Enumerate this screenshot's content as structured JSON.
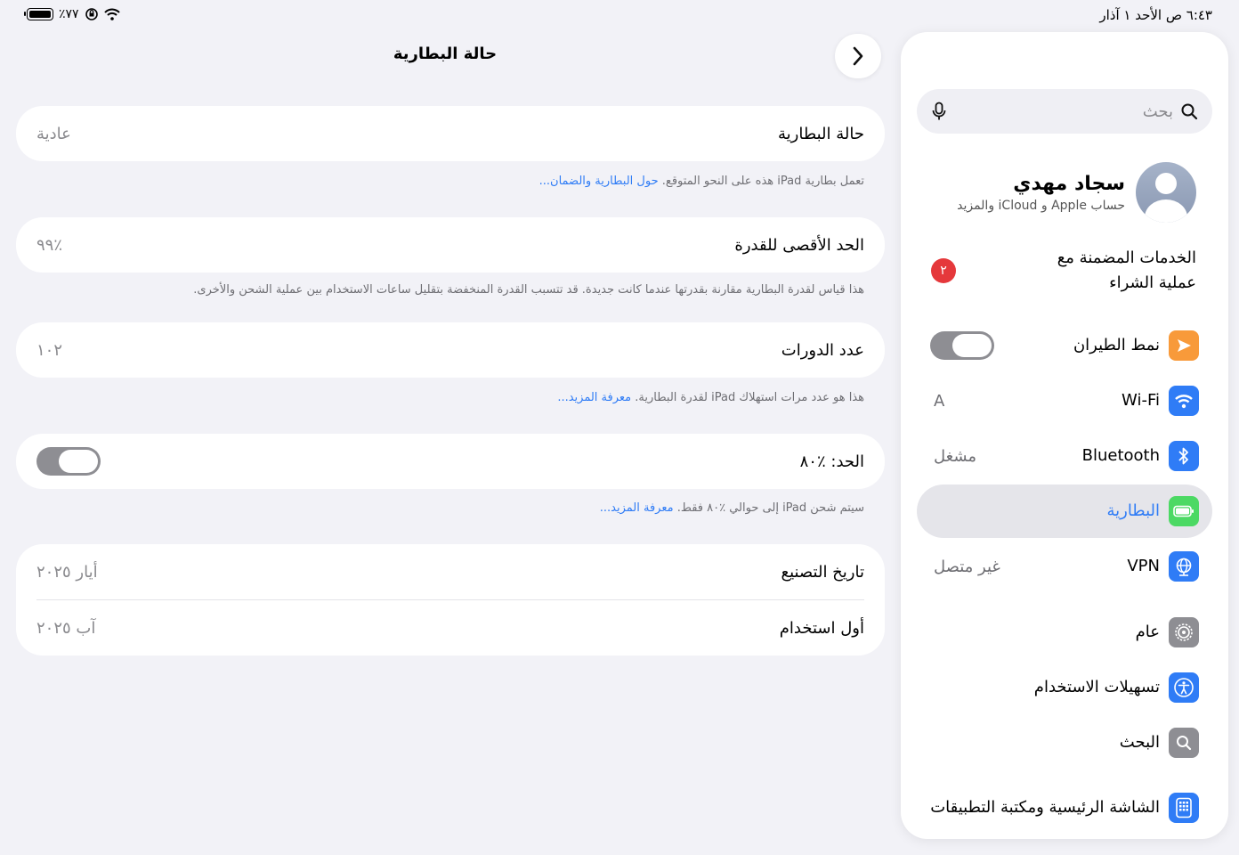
{
  "status_bar": {
    "time_date": "٦:٤٣ ص  الأحد ١ آذار",
    "battery_percent": "٪٧٧"
  },
  "sidebar": {
    "search_placeholder": "بحث",
    "profile_name": "سجاد مهدي",
    "profile_sub": "حساب Apple و iCloud والمزيد",
    "services_label": "الخدمات المضمنة مع عملية الشراء",
    "services_badge": "٢",
    "items": [
      {
        "label": "نمط الطيران",
        "value": "",
        "icon": "airplane-icon",
        "color": "#f89a3a",
        "toggle": true
      },
      {
        "label": "Wi-Fi",
        "value": "A",
        "icon": "wifi-icon",
        "color": "#2f7cf6"
      },
      {
        "label": "Bluetooth",
        "value": "مشغل",
        "icon": "bluetooth-icon",
        "color": "#2f7cf6"
      },
      {
        "label": "البطارية",
        "value": "",
        "icon": "battery-icon",
        "color": "#4cd964",
        "selected": true
      },
      {
        "label": "VPN",
        "value": "غير متصل",
        "icon": "globe-icon",
        "color": "#2f7cf6"
      },
      {
        "label": "عام",
        "value": "",
        "icon": "gear-icon",
        "color": "#8e8e93"
      },
      {
        "label": "تسهيلات الاستخدام",
        "value": "",
        "icon": "accessibility-icon",
        "color": "#2f7cf6"
      },
      {
        "label": "البحث",
        "value": "",
        "icon": "search-icon",
        "color": "#8e8e93"
      },
      {
        "label": "الشاشة الرئيسية ومكتبة التطبيقات",
        "value": "",
        "icon": "home-screen-icon",
        "color": "#2f7cf6"
      }
    ]
  },
  "main": {
    "title": "حالة البطارية",
    "battery_health_label": "حالة البطارية",
    "battery_health_value": "عادية",
    "battery_health_note": "تعمل بطارية iPad هذه على النحو المتوقع.",
    "battery_health_link": "حول البطارية والضمان...",
    "max_capacity_label": "الحد الأقصى للقدرة",
    "max_capacity_value": "٪٩٩",
    "max_capacity_note": "هذا قياس لقدرة البطارية مقارنة بقدرتها عندما كانت جديدة. قد تتسبب القدرة المنخفضة بتقليل ساعات الاستخدام بين عملية الشحن والأخرى.",
    "cycle_count_label": "عدد الدورات",
    "cycle_count_value": "١٠٢",
    "cycle_count_note": "هذا هو عدد مرات استهلاك iPad لقدرة البطارية.",
    "cycle_count_link": "معرفة المزيد...",
    "limit_label": "الحد: ٪٨٠",
    "limit_note": "سيتم شحن iPad إلى حوالي ٪٨٠ فقط.",
    "limit_link": "معرفة المزيد...",
    "manufacture_label": "تاريخ التصنيع",
    "manufacture_value": "أيار ٢٠٢٥",
    "first_use_label": "أول استخدام",
    "first_use_value": "آب ٢٠٢٥"
  }
}
